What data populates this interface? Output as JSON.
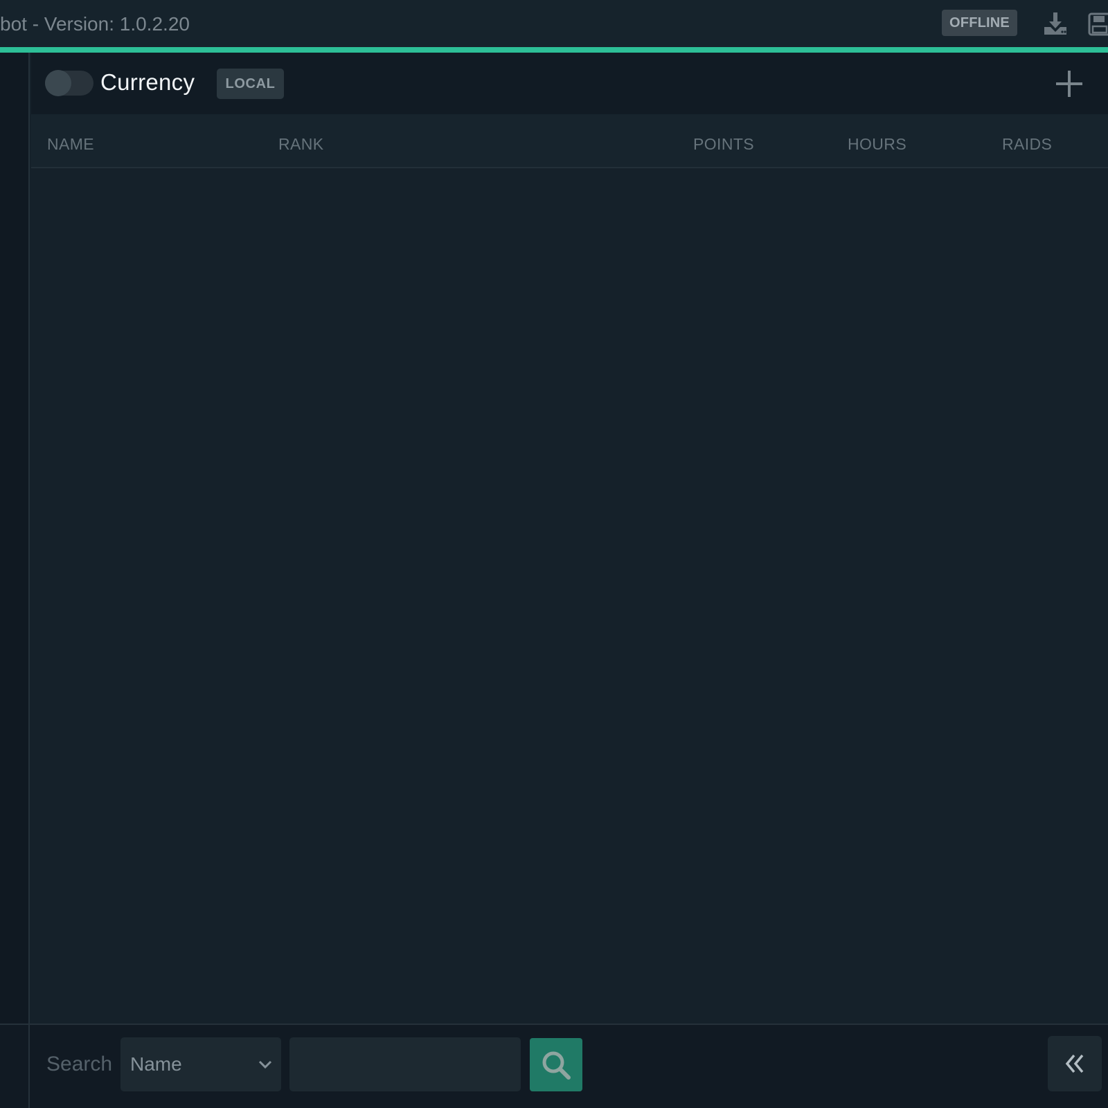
{
  "titlebar": {
    "title": "bot - Version: 1.0.2.20",
    "status": "OFFLINE",
    "icons": [
      "download-icon",
      "save-icon"
    ]
  },
  "panel": {
    "title": "Currency",
    "scope_badge": "LOCAL",
    "toggle_on": false,
    "add_icon": "plus-icon"
  },
  "table": {
    "columns": [
      "NAME",
      "RANK",
      "POINTS",
      "HOURS",
      "RAIDS"
    ],
    "rows": []
  },
  "footer": {
    "search_label": "Search",
    "field_select": {
      "selected": "Name"
    },
    "search_input": {
      "value": "",
      "placeholder": ""
    },
    "search_icon": "search-icon",
    "collapse_icon": "double-chevron-left-icon"
  },
  "colors": {
    "accent": "#2dbf97",
    "search_button": "#207a66",
    "background": "#15212a"
  }
}
